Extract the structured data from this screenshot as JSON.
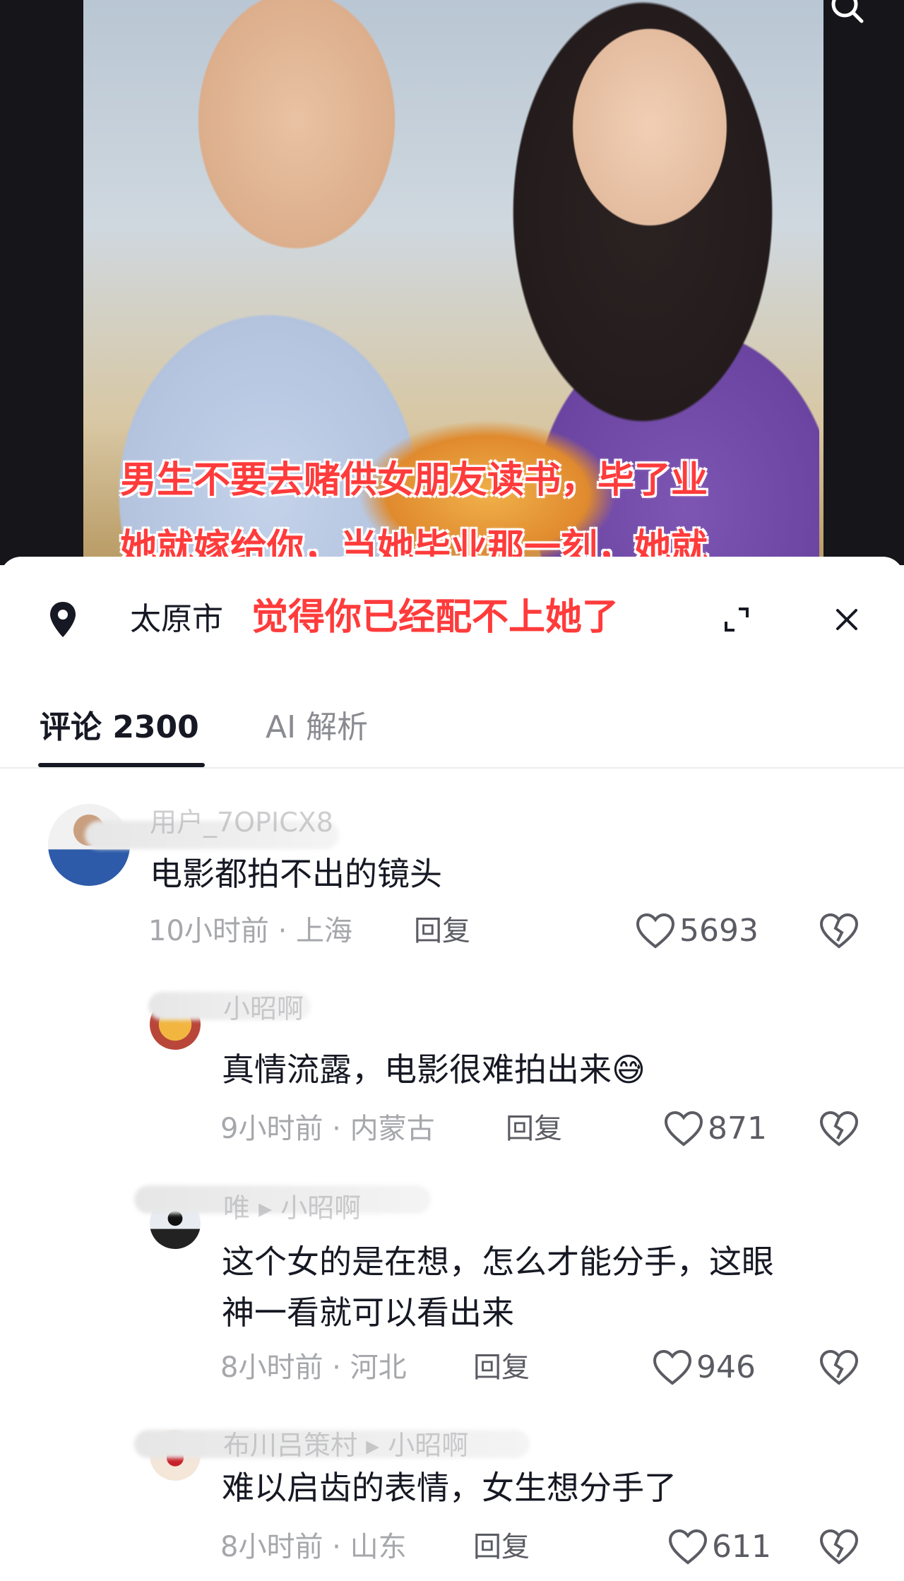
{
  "video": {
    "caption_line1": "男生不要去赌供女朋友读书，毕了业",
    "caption_line2": "她就嫁给你，当她毕业那一刻，她就",
    "caption_line3": "觉得你已经配不上她了",
    "search_icon": "search-icon"
  },
  "location_bar": {
    "location": "太原市",
    "icons": [
      "location-pin-icon",
      "expand-icon",
      "close-icon"
    ]
  },
  "tabs": {
    "comments_label": "评论 2300",
    "ai_label": "AI 解析"
  },
  "comments": [
    {
      "username": "用户_7OPICX8",
      "text": "电影都拍不出的镜头",
      "meta": "10小时前 · 上海",
      "reply_label": "回复",
      "likes": "5693"
    },
    {
      "username": "小昭啊",
      "text": "真情流露，电影很难拍出来😅",
      "meta": "9小时前 · 内蒙古",
      "reply_label": "回复",
      "likes": "871"
    },
    {
      "username": "唯 ▸ 小昭啊",
      "text_line1": "这个女的是在想，怎么才能分手，这眼",
      "text_line2": "神一看就可以看出来",
      "meta": "8小时前 · 河北",
      "reply_label": "回复",
      "likes": "946"
    },
    {
      "username": "布川吕策村 ▸ 小昭啊",
      "text": "难以启齿的表情，女生想分手了",
      "meta": "8小时前 · 山东",
      "reply_label": "回复",
      "likes": "611"
    }
  ],
  "colors": {
    "caption_red": "#ff3b3b",
    "text_primary": "#161823",
    "text_secondary": "#a6a7ab"
  }
}
